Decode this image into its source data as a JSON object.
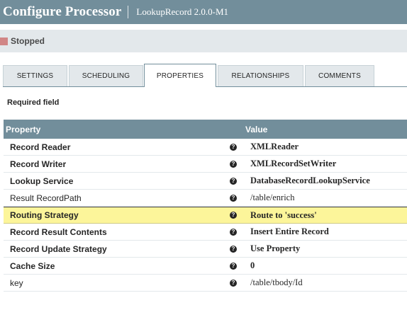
{
  "header": {
    "title": "Configure Processor",
    "subtitle": "LookupRecord 2.0.0-M1"
  },
  "status": {
    "label": "Stopped",
    "color": "#d18686"
  },
  "tabs": [
    {
      "label": "SETTINGS",
      "active": false
    },
    {
      "label": "SCHEDULING",
      "active": false
    },
    {
      "label": "PROPERTIES",
      "active": true
    },
    {
      "label": "RELATIONSHIPS",
      "active": false
    },
    {
      "label": "COMMENTS",
      "active": false
    }
  ],
  "required_note": "Required field",
  "table": {
    "columns": [
      "Property",
      "Value"
    ],
    "rows": [
      {
        "name": "Record Reader",
        "value": "XMLReader",
        "required": true
      },
      {
        "name": "Record Writer",
        "value": "XMLRecordSetWriter",
        "required": true
      },
      {
        "name": "Lookup Service",
        "value": "DatabaseRecordLookupService",
        "required": true
      },
      {
        "name": "Result RecordPath",
        "value": "/table/enrich",
        "required": false
      },
      {
        "name": "Routing Strategy",
        "value": "Route to 'success'",
        "required": true,
        "highlighted": true
      },
      {
        "name": "Record Result Contents",
        "value": "Insert Entire Record",
        "required": true
      },
      {
        "name": "Record Update Strategy",
        "value": "Use Property",
        "required": true
      },
      {
        "name": "Cache Size",
        "value": "0",
        "required": true
      },
      {
        "name": "key",
        "value": "/table/tbody/Id",
        "required": false
      }
    ]
  },
  "icons": {
    "help": "help-circle-icon"
  },
  "colors": {
    "header": "#728e9b",
    "highlight": "#fcf59a",
    "status_bar": "#e3e8eb"
  }
}
